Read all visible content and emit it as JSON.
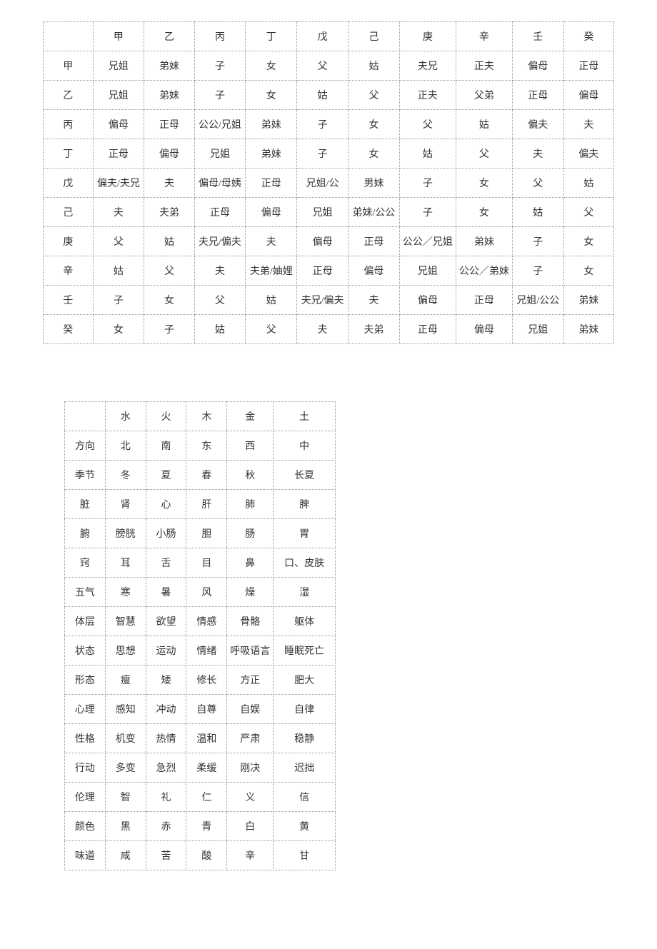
{
  "table1": {
    "rows": [
      [
        "",
        "甲",
        "乙",
        "丙",
        "丁",
        "戊",
        "己",
        "庚",
        "辛",
        "壬",
        "癸"
      ],
      [
        "甲",
        "兄姐",
        "弟妹",
        "子",
        "女",
        "父",
        "姑",
        "夫兄",
        "正夫",
        "偏母",
        "正母"
      ],
      [
        "乙",
        "兄姐",
        "弟妹",
        "子",
        "女",
        "姑",
        "父",
        "正夫",
        "父弟",
        "正母",
        "偏母"
      ],
      [
        "丙",
        "偏母",
        "正母",
        "公公/兄姐",
        "弟妹",
        "子",
        "女",
        "父",
        "姑",
        "偏夫",
        "夫"
      ],
      [
        "丁",
        "正母",
        "偏母",
        "兄姐",
        "弟妹",
        "子",
        "女",
        "姑",
        "父",
        "夫",
        "偏夫"
      ],
      [
        "戊",
        "偏夫/夫兄",
        "夫",
        "偏母/母姨",
        "正母",
        "兄姐/公",
        "男妹",
        "子",
        "女",
        "父",
        "姑"
      ],
      [
        "己",
        "夫",
        "夫弟",
        "正母",
        "偏母",
        "兄姐",
        "弟妹/公公",
        "子",
        "女",
        "姑",
        "父"
      ],
      [
        "庚",
        "父",
        "姑",
        "夫兄/偏夫",
        "夫",
        "偏母",
        "正母",
        "公公／兄姐",
        "弟妹",
        "子",
        "女"
      ],
      [
        "辛",
        "姑",
        "父",
        "夫",
        "夫弟/妯娌",
        "正母",
        "偏母",
        "兄姐",
        "公公／弟妹",
        "子",
        "女"
      ],
      [
        "壬",
        "子",
        "女",
        "父",
        "姑",
        "夫兄/偏夫",
        "夫",
        "偏母",
        "正母",
        "兄姐/公公",
        "弟妹"
      ],
      [
        "癸",
        "女",
        "子",
        "姑",
        "父",
        "夫",
        "夫弟",
        "正母",
        "偏母",
        "兄姐",
        "弟妹"
      ]
    ]
  },
  "table2": {
    "rows": [
      [
        "",
        "水",
        "火",
        "木",
        "金",
        "土"
      ],
      [
        "方向",
        "北",
        "南",
        "东",
        "西",
        "中"
      ],
      [
        "季节",
        "冬",
        "夏",
        "春",
        "秋",
        "长夏"
      ],
      [
        "脏",
        "肾",
        "心",
        "肝",
        "肺",
        "脾"
      ],
      [
        "腑",
        "膀胱",
        "小肠",
        "胆",
        "肠",
        "胃"
      ],
      [
        "窍",
        "耳",
        "舌",
        "目",
        "鼻",
        "口、皮肤"
      ],
      [
        "五气",
        "寒",
        "暑",
        "风",
        "燥",
        "湿"
      ],
      [
        "体层",
        "智慧",
        "欲望",
        "情感",
        "骨骼",
        "躯体"
      ],
      [
        "状态",
        "思想",
        "运动",
        "情绪",
        "呼吸语言",
        "睡眠死亡"
      ],
      [
        "形态",
        "瘦",
        "矮",
        "修长",
        "方正",
        "肥大"
      ],
      [
        "心理",
        "感知",
        "冲动",
        "自尊",
        "自娱",
        "自律"
      ],
      [
        "性格",
        "机变",
        "热情",
        "温和",
        "严肃",
        "稳静"
      ],
      [
        "行动",
        "多变",
        "急烈",
        "柔缓",
        "刚决",
        "迟拙"
      ],
      [
        "伦理",
        "智",
        "礼",
        "仁",
        "义",
        "信"
      ],
      [
        "颜色",
        "黑",
        "赤",
        "青",
        "白",
        "黄"
      ],
      [
        "味道",
        "咸",
        "苦",
        "酸",
        "辛",
        "甘"
      ]
    ]
  }
}
